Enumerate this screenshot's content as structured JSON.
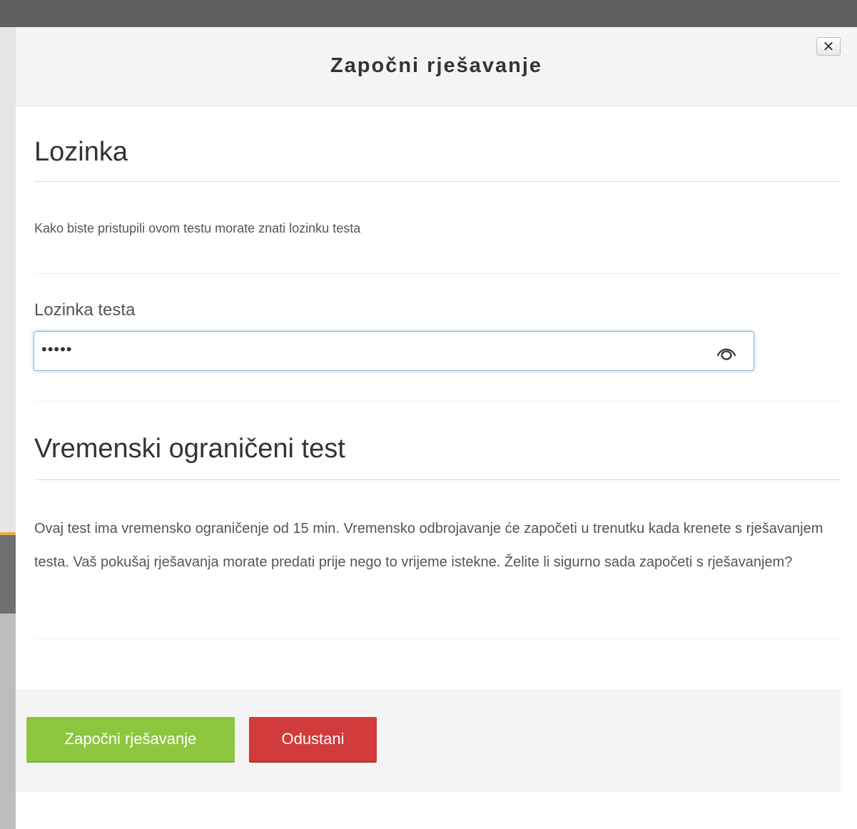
{
  "modal": {
    "title": "Započni rješavanje",
    "close_label": "✕"
  },
  "password_section": {
    "heading": "Lozinka",
    "description": "Kako biste pristupili ovom testu morate znati lozinku testa",
    "field_label": "Lozinka testa",
    "field_value": "•••••",
    "toggle_icon": "eye-icon"
  },
  "time_section": {
    "heading": "Vremenski ograničeni test",
    "description": "Ovaj test ima vremensko ograničenje od 15 min. Vremensko odbrojavanje će započeti u trenutku kada krenete s rješavanjem testa. Vaš pokušaj rješavanja morate predati prije nego to vrijeme istekne. Želite li sigurno sada započeti s rješavanjem?"
  },
  "footer": {
    "start_label": "Započni rješavanje",
    "cancel_label": "Odustani"
  },
  "colors": {
    "start_button": "#8cc63f",
    "cancel_button": "#d13b3b",
    "input_focus": "#7db5e8"
  }
}
